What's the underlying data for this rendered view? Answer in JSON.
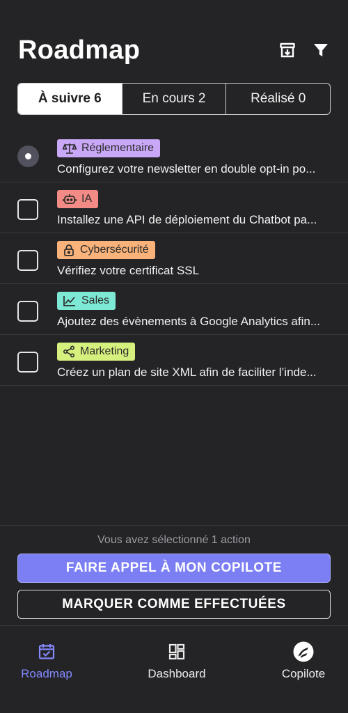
{
  "header": {
    "title": "Roadmap",
    "archive_icon": "archive-icon",
    "filter_icon": "filter-icon"
  },
  "tabs": [
    {
      "label": "À suivre 6",
      "active": true
    },
    {
      "label": "En cours 2",
      "active": false
    },
    {
      "label": "Réalisé 0",
      "active": false
    }
  ],
  "items": [
    {
      "tag": "Réglementaire",
      "tag_icon": "scale-icon",
      "tag_color": "#c9a8f7",
      "text": "Configurez votre newsletter en double opt-in po...",
      "selected": true
    },
    {
      "tag": "IA",
      "tag_icon": "robot-icon",
      "tag_color": "#f28b86",
      "text": "Installez une API de déploiement du Chatbot pa...",
      "selected": false
    },
    {
      "tag": "Cybersécurité",
      "tag_icon": "lock-icon",
      "tag_color": "#f8b27a",
      "text": "Vérifiez votre certificat SSL",
      "selected": false
    },
    {
      "tag": "Sales",
      "tag_icon": "chart-line-icon",
      "tag_color": "#7de8d3",
      "text": "Ajoutez des évènements à Google Analytics afin...",
      "selected": false
    },
    {
      "tag": "Marketing",
      "tag_icon": "share-icon",
      "tag_color": "#d6f07e",
      "text": "Créez un plan de site XML afin de faciliter l’inde...",
      "selected": false
    }
  ],
  "footer": {
    "selected_text": "Vous avez sélectionné 1 action",
    "primary_label": "FAIRE APPEL À MON COPILOTE",
    "secondary_label": "MARQUER COMME  EFFECTUÉES",
    "primary_color": "#7b7ff3"
  },
  "nav": [
    {
      "label": "Roadmap",
      "icon": "calendar-check-icon",
      "active": true
    },
    {
      "label": "Dashboard",
      "icon": "dashboard-icon",
      "active": false
    },
    {
      "label": "Copilote",
      "icon": "copilote-logo-icon",
      "active": false
    }
  ],
  "colors": {
    "background": "#242427",
    "accent": "#8489ff"
  }
}
